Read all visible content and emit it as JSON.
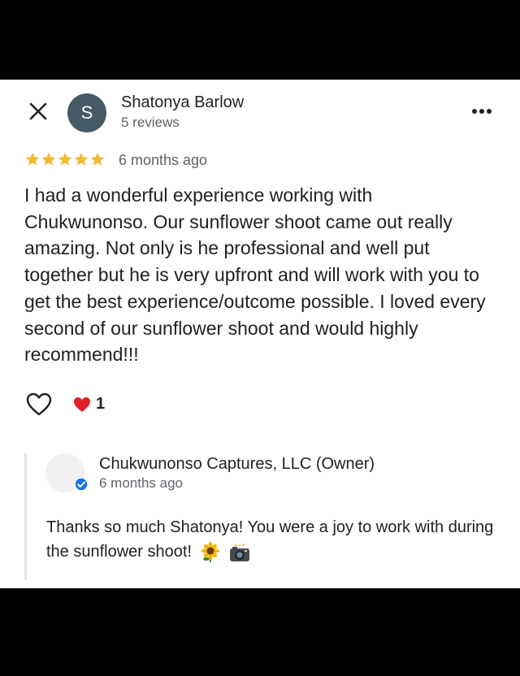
{
  "review": {
    "reviewer_initial": "S",
    "reviewer_name": "Shatonya Barlow",
    "reviewer_reviews": "5 reviews",
    "rating": 5,
    "age": "6 months ago",
    "text": "I had a wonderful experience working with Chukwunonso. Our sunflower shoot came out really amazing. Not only is he professional and well put together but he is very upfront and will work with you to get the best experience/outcome possible. I loved every second of our sunflower shoot and would highly recommend!!!",
    "reaction_count": "1"
  },
  "reply": {
    "owner_name": "Chukwunonso Captures, LLC (Owner)",
    "age": "6 months ago",
    "text": "Thanks so much Shatonya! You were a joy to work with during the sunflower shoot!"
  },
  "colors": {
    "star": "#f5b82e",
    "avatar": "#455a64",
    "verified": "#1a73e8",
    "heart": "#e0202b"
  }
}
